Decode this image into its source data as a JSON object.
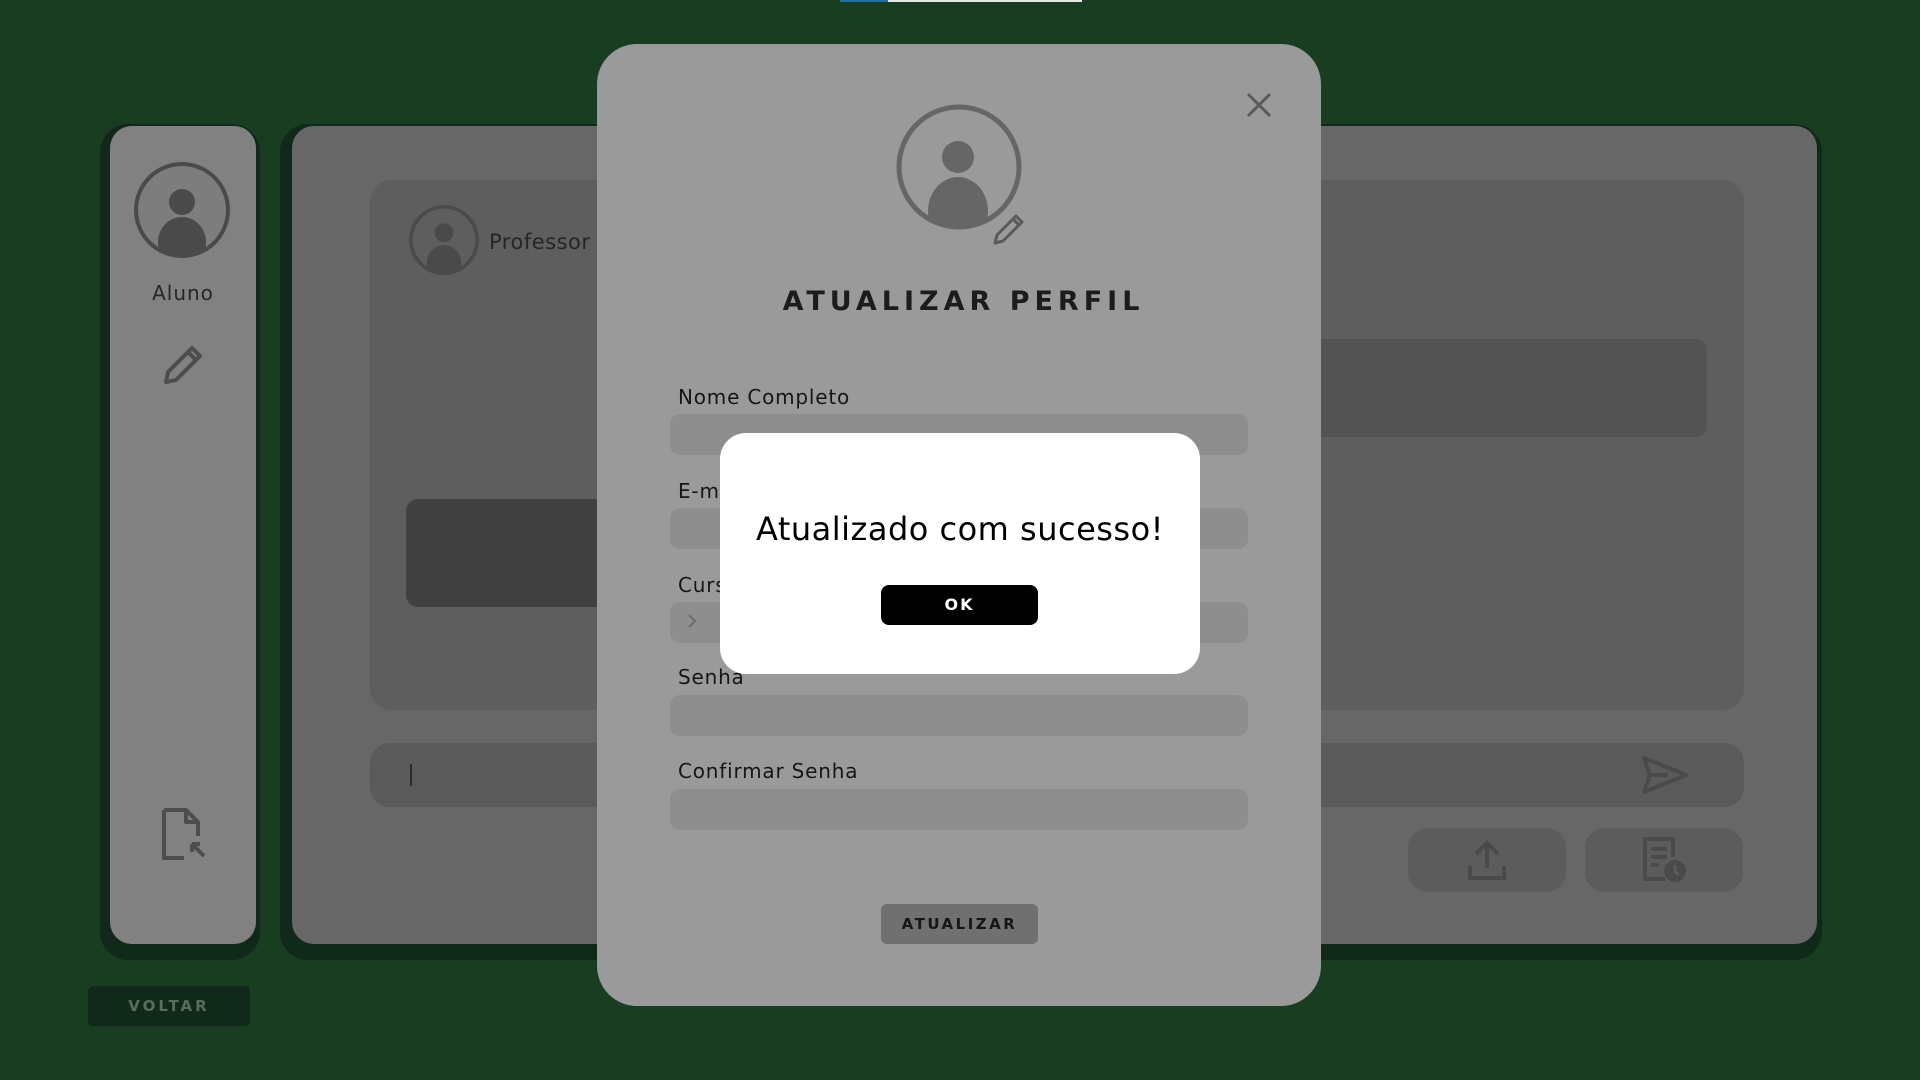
{
  "sidebar": {
    "user_role": "Aluno",
    "edit_icon": "pencil-icon",
    "export_icon": "file-export-icon"
  },
  "chat": {
    "contact_name": "Professor",
    "send_icon": "send-icon",
    "upload_icon": "upload-icon",
    "history_icon": "history-report-icon"
  },
  "back_button": {
    "label": "VOLTAR"
  },
  "profile_modal": {
    "title": "ATUALIZAR PERFIL",
    "close_icon": "close-icon",
    "fields": {
      "name_label": "Nome Completo",
      "email_label": "E-mail",
      "course_label": "Curso",
      "password_label": "Senha",
      "confirm_password_label": "Confirmar Senha"
    },
    "submit_label": "ATUALIZAR"
  },
  "alert": {
    "message": "Atualizado com sucesso!",
    "ok_label": "OK"
  },
  "colors": {
    "background": "#193d20",
    "panel_dark": "#10291a",
    "modal": "#9a9a9a",
    "alert": "#ffffff",
    "ok_button": "#000000"
  }
}
